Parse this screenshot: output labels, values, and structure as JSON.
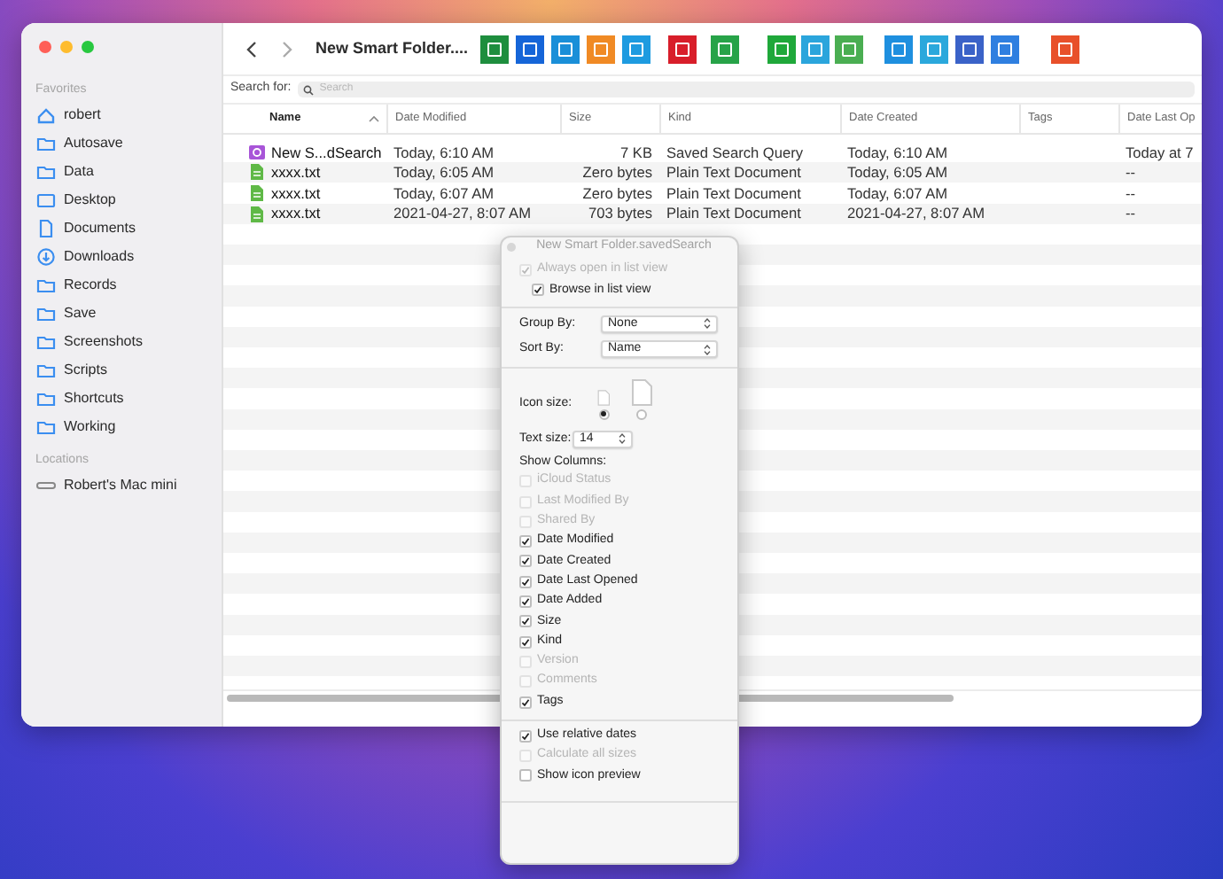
{
  "window": {
    "title": "New Smart Folder...."
  },
  "sidebar": {
    "sections": [
      {
        "label": "Favorites",
        "items": [
          {
            "label": "robert",
            "kind": "home"
          },
          {
            "label": "Autosave",
            "kind": "folder"
          },
          {
            "label": "Data",
            "kind": "folder"
          },
          {
            "label": "Desktop",
            "kind": "desktop"
          },
          {
            "label": "Documents",
            "kind": "document"
          },
          {
            "label": "Downloads",
            "kind": "download"
          },
          {
            "label": "Records",
            "kind": "folder"
          },
          {
            "label": "Save",
            "kind": "folder"
          },
          {
            "label": "Screenshots",
            "kind": "folder"
          },
          {
            "label": "Scripts",
            "kind": "folder"
          },
          {
            "label": "Shortcuts",
            "kind": "folder"
          },
          {
            "label": "Working",
            "kind": "folder"
          }
        ]
      },
      {
        "label": "Locations",
        "items": [
          {
            "label": "Robert's Mac mini",
            "kind": "drive"
          }
        ]
      }
    ]
  },
  "search": {
    "label": "Search for:",
    "placeholder": "Search"
  },
  "table": {
    "columns": [
      {
        "label": "Name",
        "sorted": true
      },
      {
        "label": "Date Modified",
        "sorted": false
      },
      {
        "label": "Size",
        "sorted": false
      },
      {
        "label": "Kind",
        "sorted": false
      },
      {
        "label": "Date Created",
        "sorted": false
      },
      {
        "label": "Tags",
        "sorted": false
      },
      {
        "label": "Date Last Op",
        "sorted": false
      }
    ],
    "rows": [
      {
        "kind": "saved-search",
        "cells": [
          "New S...dSearch",
          "Today, 6:10 AM",
          "7 KB",
          "Saved Search Query",
          "Today, 6:10 AM",
          "",
          "Today at 7"
        ]
      },
      {
        "kind": "text",
        "cells": [
          "xxxx.txt",
          "Today, 6:05 AM",
          "Zero bytes",
          "Plain Text Document",
          "Today, 6:05 AM",
          "",
          "--"
        ]
      },
      {
        "kind": "text",
        "cells": [
          "xxxx.txt",
          "Today, 6:07 AM",
          "Zero bytes",
          "Plain Text Document",
          "Today, 6:07 AM",
          "",
          "--"
        ]
      },
      {
        "kind": "text",
        "cells": [
          "xxxx.txt",
          "2021-04-27, 8:07 AM",
          "703 bytes",
          "Plain Text Document",
          "2021-04-27, 8:07 AM",
          "",
          "--"
        ]
      }
    ]
  },
  "view_options": {
    "title": "New Smart Folder.savedSearch",
    "options_top": [
      {
        "label": "Always open in list view",
        "checked": true,
        "disabled": true
      },
      {
        "label": "Browse in list view",
        "checked": true,
        "disabled": false
      }
    ],
    "selects": [
      {
        "label": "Group By:",
        "value": "None"
      },
      {
        "label": "Sort By:",
        "value": "Name"
      }
    ],
    "icon_size": {
      "label": "Icon size:",
      "choices": [
        {
          "selected": true
        },
        {
          "selected": false
        }
      ]
    },
    "text_size": {
      "label": "Text size:",
      "value": "14"
    },
    "show_columns": {
      "label": "Show Columns:",
      "items": [
        {
          "label": "iCloud Status",
          "checked": false,
          "disabled": true
        },
        {
          "label": "Last Modified By",
          "checked": false,
          "disabled": true
        },
        {
          "label": "Shared By",
          "checked": false,
          "disabled": true
        },
        {
          "label": "Date Modified",
          "checked": true,
          "disabled": false
        },
        {
          "label": "Date Created",
          "checked": true,
          "disabled": false
        },
        {
          "label": "Date Last Opened",
          "checked": true,
          "disabled": false
        },
        {
          "label": "Date Added",
          "checked": true,
          "disabled": false
        },
        {
          "label": "Size",
          "checked": true,
          "disabled": false
        },
        {
          "label": "Kind",
          "checked": true,
          "disabled": false
        },
        {
          "label": "Version",
          "checked": false,
          "disabled": true
        },
        {
          "label": "Comments",
          "checked": false,
          "disabled": true
        },
        {
          "label": "Tags",
          "checked": true,
          "disabled": false
        }
      ]
    },
    "options_bottom": [
      {
        "label": "Use relative dates",
        "checked": true,
        "disabled": false
      },
      {
        "label": "Calculate all sizes",
        "checked": false,
        "disabled": true
      },
      {
        "label": "Show icon preview",
        "checked": false,
        "disabled": false
      }
    ]
  }
}
